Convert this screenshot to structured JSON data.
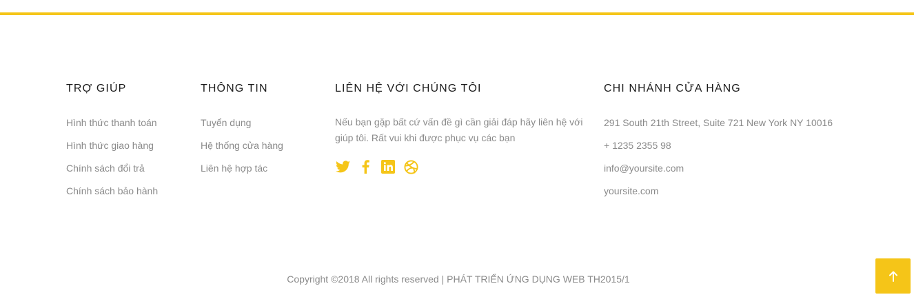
{
  "colors": {
    "accent": "#f5c518",
    "text_muted": "#8a8a8a",
    "heading": "#1c1c1c"
  },
  "help": {
    "title": "TRỢ GIÚP",
    "links": [
      "Hình thức thanh toán",
      "Hình thức giao hàng",
      "Chính sách đổi trả",
      "Chính sách bảo hành"
    ]
  },
  "info": {
    "title": "THÔNG TIN",
    "links": [
      "Tuyển dụng",
      "Hệ thống cửa hàng",
      "Liên hệ hợp tác"
    ]
  },
  "contact": {
    "title": "LIÊN HỆ VỚI CHÚNG TÔI",
    "text": "Nếu bạn gặp bất cứ vấn đề gì cần giải đáp hãy liên hệ với giúp tôi. Rất vui khi được phục vụ các bạn",
    "social_icons": [
      "twitter-icon",
      "facebook-icon",
      "linkedin-icon",
      "dribbble-icon"
    ]
  },
  "branch": {
    "title": "CHI NHÁNH CỬA HÀNG",
    "address": "291 South 21th Street, Suite 721 New York NY 10016",
    "phone": "+ 1235 2355 98",
    "email": "info@yoursite.com",
    "website": "yoursite.com"
  },
  "footer": {
    "copyright": "Copyright ©2018 All rights reserved | PHÁT TRIỂN ỨNG DỤNG WEB TH2015/1"
  },
  "back_to_top": {
    "icon": "arrow-up-icon"
  }
}
